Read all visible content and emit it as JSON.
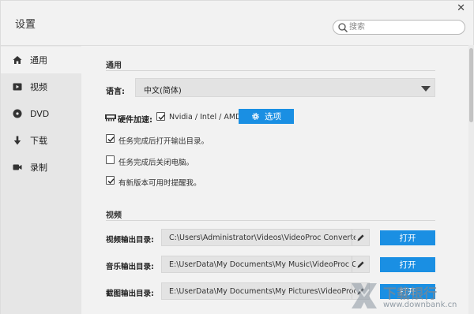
{
  "window": {
    "title": "设置",
    "close_glyph": "✕"
  },
  "search": {
    "placeholder": "搜索",
    "value": ""
  },
  "sidebar": {
    "items": [
      {
        "label": "通用",
        "icon": "home-icon",
        "active": true
      },
      {
        "label": "视频",
        "icon": "video-icon",
        "active": false
      },
      {
        "label": "DVD",
        "icon": "disc-icon",
        "active": false
      },
      {
        "label": "下载",
        "icon": "download-icon",
        "active": false
      },
      {
        "label": "录制",
        "icon": "camera-icon",
        "active": false
      }
    ]
  },
  "general": {
    "heading": "通用",
    "language_label": "语言:",
    "language_value": "中文(简体)",
    "hw_label": "硬件加速:",
    "hw_checkbox_text": "Nvidia / Intel / AMD",
    "hw_checked": true,
    "options_button": "选项",
    "checkboxes": [
      {
        "text": "任务完成后打开输出目录。",
        "checked": true
      },
      {
        "text": "任务完成后关闭电脑。",
        "checked": false
      },
      {
        "text": "有新版本可用时提醒我。",
        "checked": true
      }
    ]
  },
  "video": {
    "heading": "视频",
    "paths": [
      {
        "label": "视频输出目录:",
        "path": "C:\\Users\\Administrator\\Videos\\VideoProc Converter",
        "button": "打开"
      },
      {
        "label": "音乐输出目录:",
        "path": "E:\\UserData\\My Documents\\My Music\\VideoProc Converter",
        "button": "打开"
      },
      {
        "label": "截图输出目录:",
        "path": "E:\\UserData\\My Documents\\My Pictures\\VideoProc Converter",
        "button": "打开"
      }
    ]
  },
  "watermark": {
    "cn": "下载银行",
    "en": "www.downbank.cn"
  },
  "colors": {
    "accent": "#1a8fe3",
    "background": "#f2f2f2",
    "sidebar": "#e6e6e6"
  }
}
